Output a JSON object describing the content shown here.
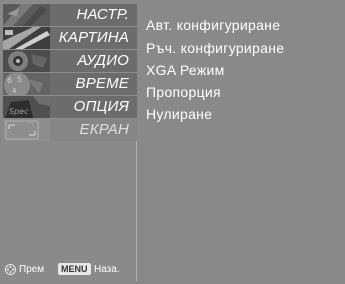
{
  "menu": {
    "items": [
      {
        "label": "НАСТР.",
        "icon": "setup-thumbnail-icon"
      },
      {
        "label": "КАРТИНА",
        "icon": "picture-thumbnail-icon"
      },
      {
        "label": "АУДИО",
        "icon": "audio-thumbnail-icon"
      },
      {
        "label": "ВРЕМЕ",
        "icon": "time-thumbnail-icon"
      },
      {
        "label": "ОПЦИЯ",
        "icon": "option-thumbnail-icon"
      },
      {
        "label": "ЕКРАН",
        "icon": "screen-thumbnail-icon",
        "selected": true
      }
    ]
  },
  "submenu": {
    "items": [
      "Авт. конфигуриране",
      "Ръч. конфигуриране",
      "XGA Режим",
      "Пропорция",
      "Нулиране"
    ]
  },
  "footer": {
    "move_label": "Прем",
    "menu_key": "MENU",
    "back_label": "Наза."
  },
  "colors": {
    "background": "#898989",
    "panel": "#6c6c6c",
    "selected": "#868686",
    "text": "#ffffff"
  }
}
